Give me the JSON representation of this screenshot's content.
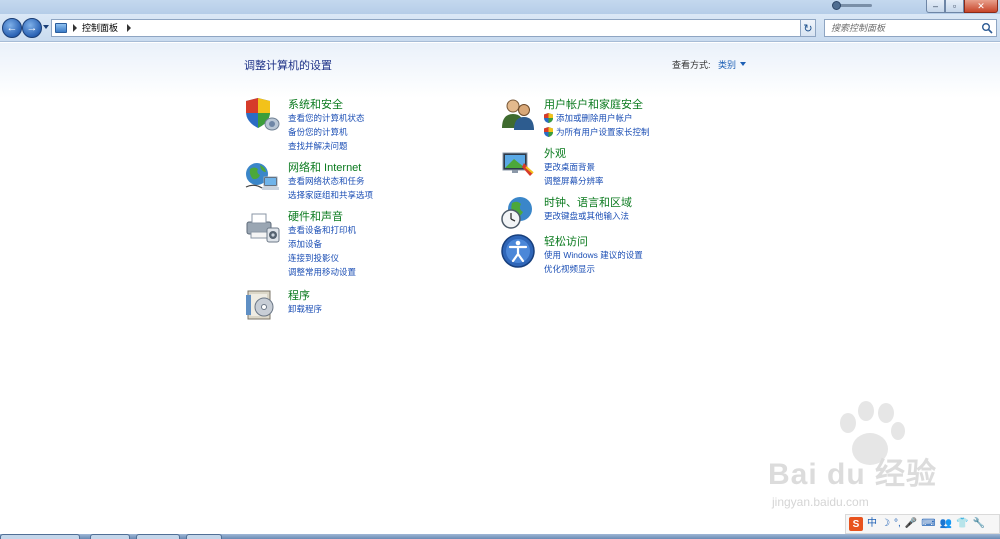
{
  "window": {
    "close_glyph": "✕",
    "max_glyph": "▫",
    "min_glyph": "–"
  },
  "address": {
    "path_root": "控制面板",
    "search_placeholder": "搜索控制面板"
  },
  "page": {
    "title": "调整计算机的设置",
    "view_by_label": "查看方式:",
    "view_by_value": "类别"
  },
  "categories": {
    "system": {
      "title": "系统和安全",
      "icon": "shield-icon",
      "links": [
        "查看您的计算机状态",
        "备份您的计算机",
        "查找并解决问题"
      ]
    },
    "network": {
      "title": "网络和 Internet",
      "icon": "network-globe-icon",
      "links": [
        "查看网络状态和任务",
        "选择家庭组和共享选项"
      ]
    },
    "hardware": {
      "title": "硬件和声音",
      "icon": "printer-icon",
      "links": [
        "查看设备和打印机",
        "添加设备",
        "连接到投影仪",
        "调整常用移动设置"
      ]
    },
    "programs": {
      "title": "程序",
      "icon": "programs-icon",
      "links": [
        "卸载程序"
      ]
    },
    "users": {
      "title": "用户帐户和家庭安全",
      "icon": "users-icon",
      "links": [
        "添加或删除用户帐户",
        "为所有用户设置家长控制"
      ]
    },
    "appearance": {
      "title": "外观",
      "icon": "appearance-icon",
      "links": [
        "更改桌面背景",
        "调整屏幕分辨率"
      ]
    },
    "clock": {
      "title": "时钟、语言和区域",
      "icon": "clock-globe-icon",
      "links": [
        "更改键盘或其他输入法"
      ]
    },
    "ease": {
      "title": "轻松访问",
      "icon": "ease-of-access-icon",
      "links": [
        "使用 Windows 建议的设置",
        "优化视频显示"
      ]
    }
  },
  "ime": {
    "logo": "S",
    "mode": "中",
    "glyphs": [
      "☽",
      "°,",
      "🎤",
      "⌨",
      "👥",
      "👕",
      "🔧"
    ]
  },
  "watermark": {
    "brand": "Bai du 经验",
    "url": "jingyan.baidu.com"
  }
}
